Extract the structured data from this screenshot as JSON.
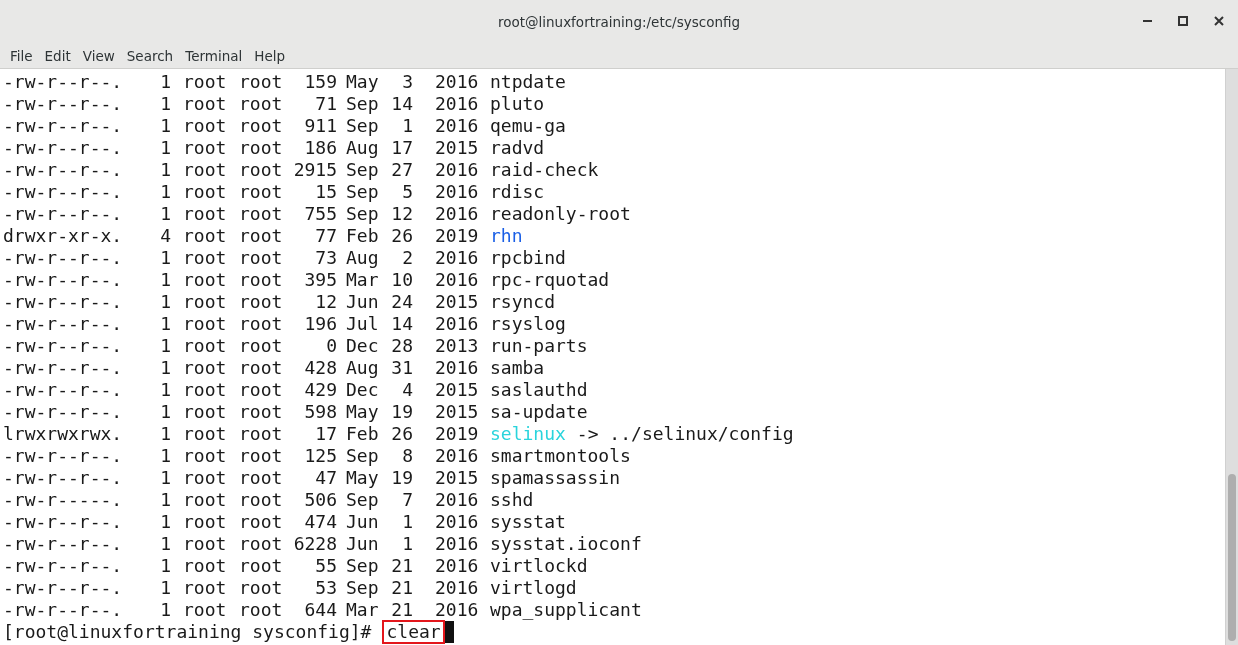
{
  "window": {
    "title": "root@linuxfortraining:/etc/sysconfig"
  },
  "menu": [
    "File",
    "Edit",
    "View",
    "Search",
    "Terminal",
    "Help"
  ],
  "listing": [
    {
      "perms": "-rw-r--r--.",
      "links": "1",
      "owner": "root",
      "group": "root",
      "size": "159",
      "month": "May",
      "day": "3",
      "year": "2016",
      "name": "ntpdate",
      "kind": "file"
    },
    {
      "perms": "-rw-r--r--.",
      "links": "1",
      "owner": "root",
      "group": "root",
      "size": "71",
      "month": "Sep",
      "day": "14",
      "year": "2016",
      "name": "pluto",
      "kind": "file"
    },
    {
      "perms": "-rw-r--r--.",
      "links": "1",
      "owner": "root",
      "group": "root",
      "size": "911",
      "month": "Sep",
      "day": "1",
      "year": "2016",
      "name": "qemu-ga",
      "kind": "file"
    },
    {
      "perms": "-rw-r--r--.",
      "links": "1",
      "owner": "root",
      "group": "root",
      "size": "186",
      "month": "Aug",
      "day": "17",
      "year": "2015",
      "name": "radvd",
      "kind": "file"
    },
    {
      "perms": "-rw-r--r--.",
      "links": "1",
      "owner": "root",
      "group": "root",
      "size": "2915",
      "month": "Sep",
      "day": "27",
      "year": "2016",
      "name": "raid-check",
      "kind": "file"
    },
    {
      "perms": "-rw-r--r--.",
      "links": "1",
      "owner": "root",
      "group": "root",
      "size": "15",
      "month": "Sep",
      "day": "5",
      "year": "2016",
      "name": "rdisc",
      "kind": "file"
    },
    {
      "perms": "-rw-r--r--.",
      "links": "1",
      "owner": "root",
      "group": "root",
      "size": "755",
      "month": "Sep",
      "day": "12",
      "year": "2016",
      "name": "readonly-root",
      "kind": "file"
    },
    {
      "perms": "drwxr-xr-x.",
      "links": "4",
      "owner": "root",
      "group": "root",
      "size": "77",
      "month": "Feb",
      "day": "26",
      "year": "2019",
      "name": "rhn",
      "kind": "dir"
    },
    {
      "perms": "-rw-r--r--.",
      "links": "1",
      "owner": "root",
      "group": "root",
      "size": "73",
      "month": "Aug",
      "day": "2",
      "year": "2016",
      "name": "rpcbind",
      "kind": "file"
    },
    {
      "perms": "-rw-r--r--.",
      "links": "1",
      "owner": "root",
      "group": "root",
      "size": "395",
      "month": "Mar",
      "day": "10",
      "year": "2016",
      "name": "rpc-rquotad",
      "kind": "file"
    },
    {
      "perms": "-rw-r--r--.",
      "links": "1",
      "owner": "root",
      "group": "root",
      "size": "12",
      "month": "Jun",
      "day": "24",
      "year": "2015",
      "name": "rsyncd",
      "kind": "file"
    },
    {
      "perms": "-rw-r--r--.",
      "links": "1",
      "owner": "root",
      "group": "root",
      "size": "196",
      "month": "Jul",
      "day": "14",
      "year": "2016",
      "name": "rsyslog",
      "kind": "file"
    },
    {
      "perms": "-rw-r--r--.",
      "links": "1",
      "owner": "root",
      "group": "root",
      "size": "0",
      "month": "Dec",
      "day": "28",
      "year": "2013",
      "name": "run-parts",
      "kind": "file"
    },
    {
      "perms": "-rw-r--r--.",
      "links": "1",
      "owner": "root",
      "group": "root",
      "size": "428",
      "month": "Aug",
      "day": "31",
      "year": "2016",
      "name": "samba",
      "kind": "file"
    },
    {
      "perms": "-rw-r--r--.",
      "links": "1",
      "owner": "root",
      "group": "root",
      "size": "429",
      "month": "Dec",
      "day": "4",
      "year": "2015",
      "name": "saslauthd",
      "kind": "file"
    },
    {
      "perms": "-rw-r--r--.",
      "links": "1",
      "owner": "root",
      "group": "root",
      "size": "598",
      "month": "May",
      "day": "19",
      "year": "2015",
      "name": "sa-update",
      "kind": "file"
    },
    {
      "perms": "lrwxrwxrwx.",
      "links": "1",
      "owner": "root",
      "group": "root",
      "size": "17",
      "month": "Feb",
      "day": "26",
      "year": "2019",
      "name": "selinux",
      "kind": "link",
      "target": "-> ../selinux/config"
    },
    {
      "perms": "-rw-r--r--.",
      "links": "1",
      "owner": "root",
      "group": "root",
      "size": "125",
      "month": "Sep",
      "day": "8",
      "year": "2016",
      "name": "smartmontools",
      "kind": "file"
    },
    {
      "perms": "-rw-r--r--.",
      "links": "1",
      "owner": "root",
      "group": "root",
      "size": "47",
      "month": "May",
      "day": "19",
      "year": "2015",
      "name": "spamassassin",
      "kind": "file"
    },
    {
      "perms": "-rw-r-----.",
      "links": "1",
      "owner": "root",
      "group": "root",
      "size": "506",
      "month": "Sep",
      "day": "7",
      "year": "2016",
      "name": "sshd",
      "kind": "file"
    },
    {
      "perms": "-rw-r--r--.",
      "links": "1",
      "owner": "root",
      "group": "root",
      "size": "474",
      "month": "Jun",
      "day": "1",
      "year": "2016",
      "name": "sysstat",
      "kind": "file"
    },
    {
      "perms": "-rw-r--r--.",
      "links": "1",
      "owner": "root",
      "group": "root",
      "size": "6228",
      "month": "Jun",
      "day": "1",
      "year": "2016",
      "name": "sysstat.ioconf",
      "kind": "file"
    },
    {
      "perms": "-rw-r--r--.",
      "links": "1",
      "owner": "root",
      "group": "root",
      "size": "55",
      "month": "Sep",
      "day": "21",
      "year": "2016",
      "name": "virtlockd",
      "kind": "file"
    },
    {
      "perms": "-rw-r--r--.",
      "links": "1",
      "owner": "root",
      "group": "root",
      "size": "53",
      "month": "Sep",
      "day": "21",
      "year": "2016",
      "name": "virtlogd",
      "kind": "file"
    },
    {
      "perms": "-rw-r--r--.",
      "links": "1",
      "owner": "root",
      "group": "root",
      "size": "644",
      "month": "Mar",
      "day": "21",
      "year": "2016",
      "name": "wpa_supplicant",
      "kind": "file"
    }
  ],
  "prompt": {
    "text": "[root@linuxfortraining sysconfig]#",
    "command": "clear",
    "highlighted": true
  }
}
